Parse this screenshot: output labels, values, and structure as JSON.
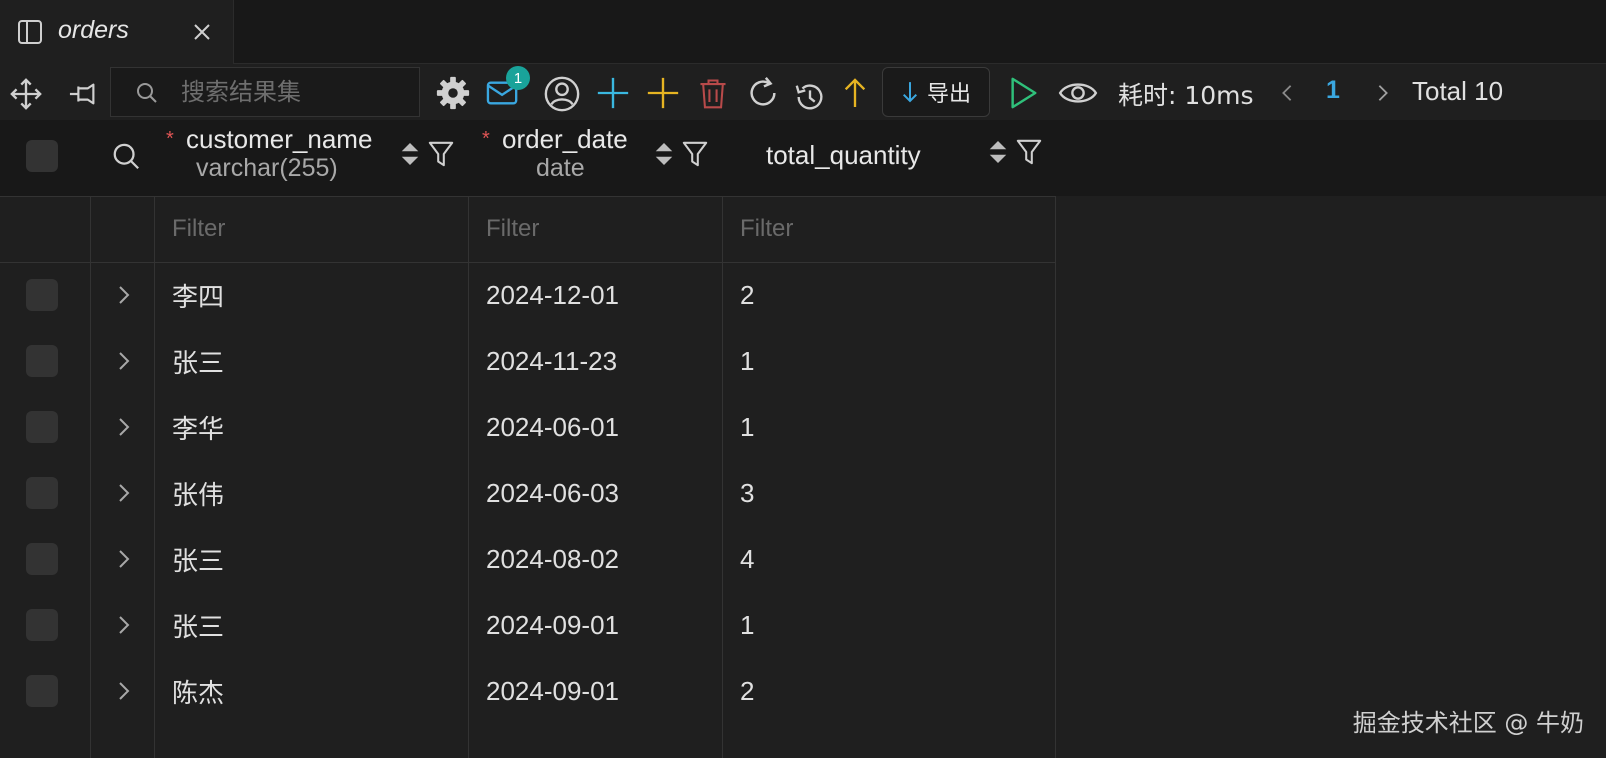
{
  "tab": {
    "title": "orders"
  },
  "toolbar": {
    "search_placeholder": "搜索结果集",
    "notification_count": "1",
    "export_label": "导出",
    "elapsed": "耗时: 10ms",
    "page": "1",
    "total": "Total 10"
  },
  "columns": [
    {
      "name": "customer_name",
      "type": "varchar(255)",
      "required": true
    },
    {
      "name": "order_date",
      "type": "date",
      "required": true
    },
    {
      "name": "total_quantity",
      "type": "",
      "required": false
    }
  ],
  "filter_placeholder": "Filter",
  "rows": [
    {
      "customer_name": "李四",
      "order_date": "2024-12-01",
      "total_quantity": "2"
    },
    {
      "customer_name": "张三",
      "order_date": "2024-11-23",
      "total_quantity": "1"
    },
    {
      "customer_name": "李华",
      "order_date": "2024-06-01",
      "total_quantity": "1"
    },
    {
      "customer_name": "张伟",
      "order_date": "2024-06-03",
      "total_quantity": "3"
    },
    {
      "customer_name": "张三",
      "order_date": "2024-08-02",
      "total_quantity": "4"
    },
    {
      "customer_name": "张三",
      "order_date": "2024-09-01",
      "total_quantity": "1"
    },
    {
      "customer_name": "陈杰",
      "order_date": "2024-09-01",
      "total_quantity": "2"
    }
  ],
  "watermark": "掘金技术社区 @ 牛奶",
  "colors": {
    "accent_blue": "#3aa7e0",
    "add_teal": "#3ab8e0",
    "add_yellow": "#e6b422",
    "delete_red": "#b84a4a",
    "run_green": "#2fc07a",
    "badge_teal": "#19a39a",
    "required_red": "#e05555"
  },
  "icons": {
    "tab": "panel-icon",
    "close": "close-icon",
    "move": "move-icon",
    "pin": "pin-icon",
    "search": "search-icon",
    "settings": "gear-icon",
    "mail": "mail-icon",
    "user": "user-circle-icon",
    "add_teal": "plus-icon",
    "add_yellow": "plus-icon",
    "delete": "trash-icon",
    "refresh": "refresh-icon",
    "history": "history-icon",
    "upload": "arrow-up-icon",
    "download": "arrow-down-icon",
    "run": "play-icon",
    "preview": "eye-icon",
    "prev": "chevron-left-icon",
    "next": "chevron-right-icon",
    "sort": "sort-icon",
    "filter": "filter-icon",
    "expand": "chevron-right-icon"
  }
}
